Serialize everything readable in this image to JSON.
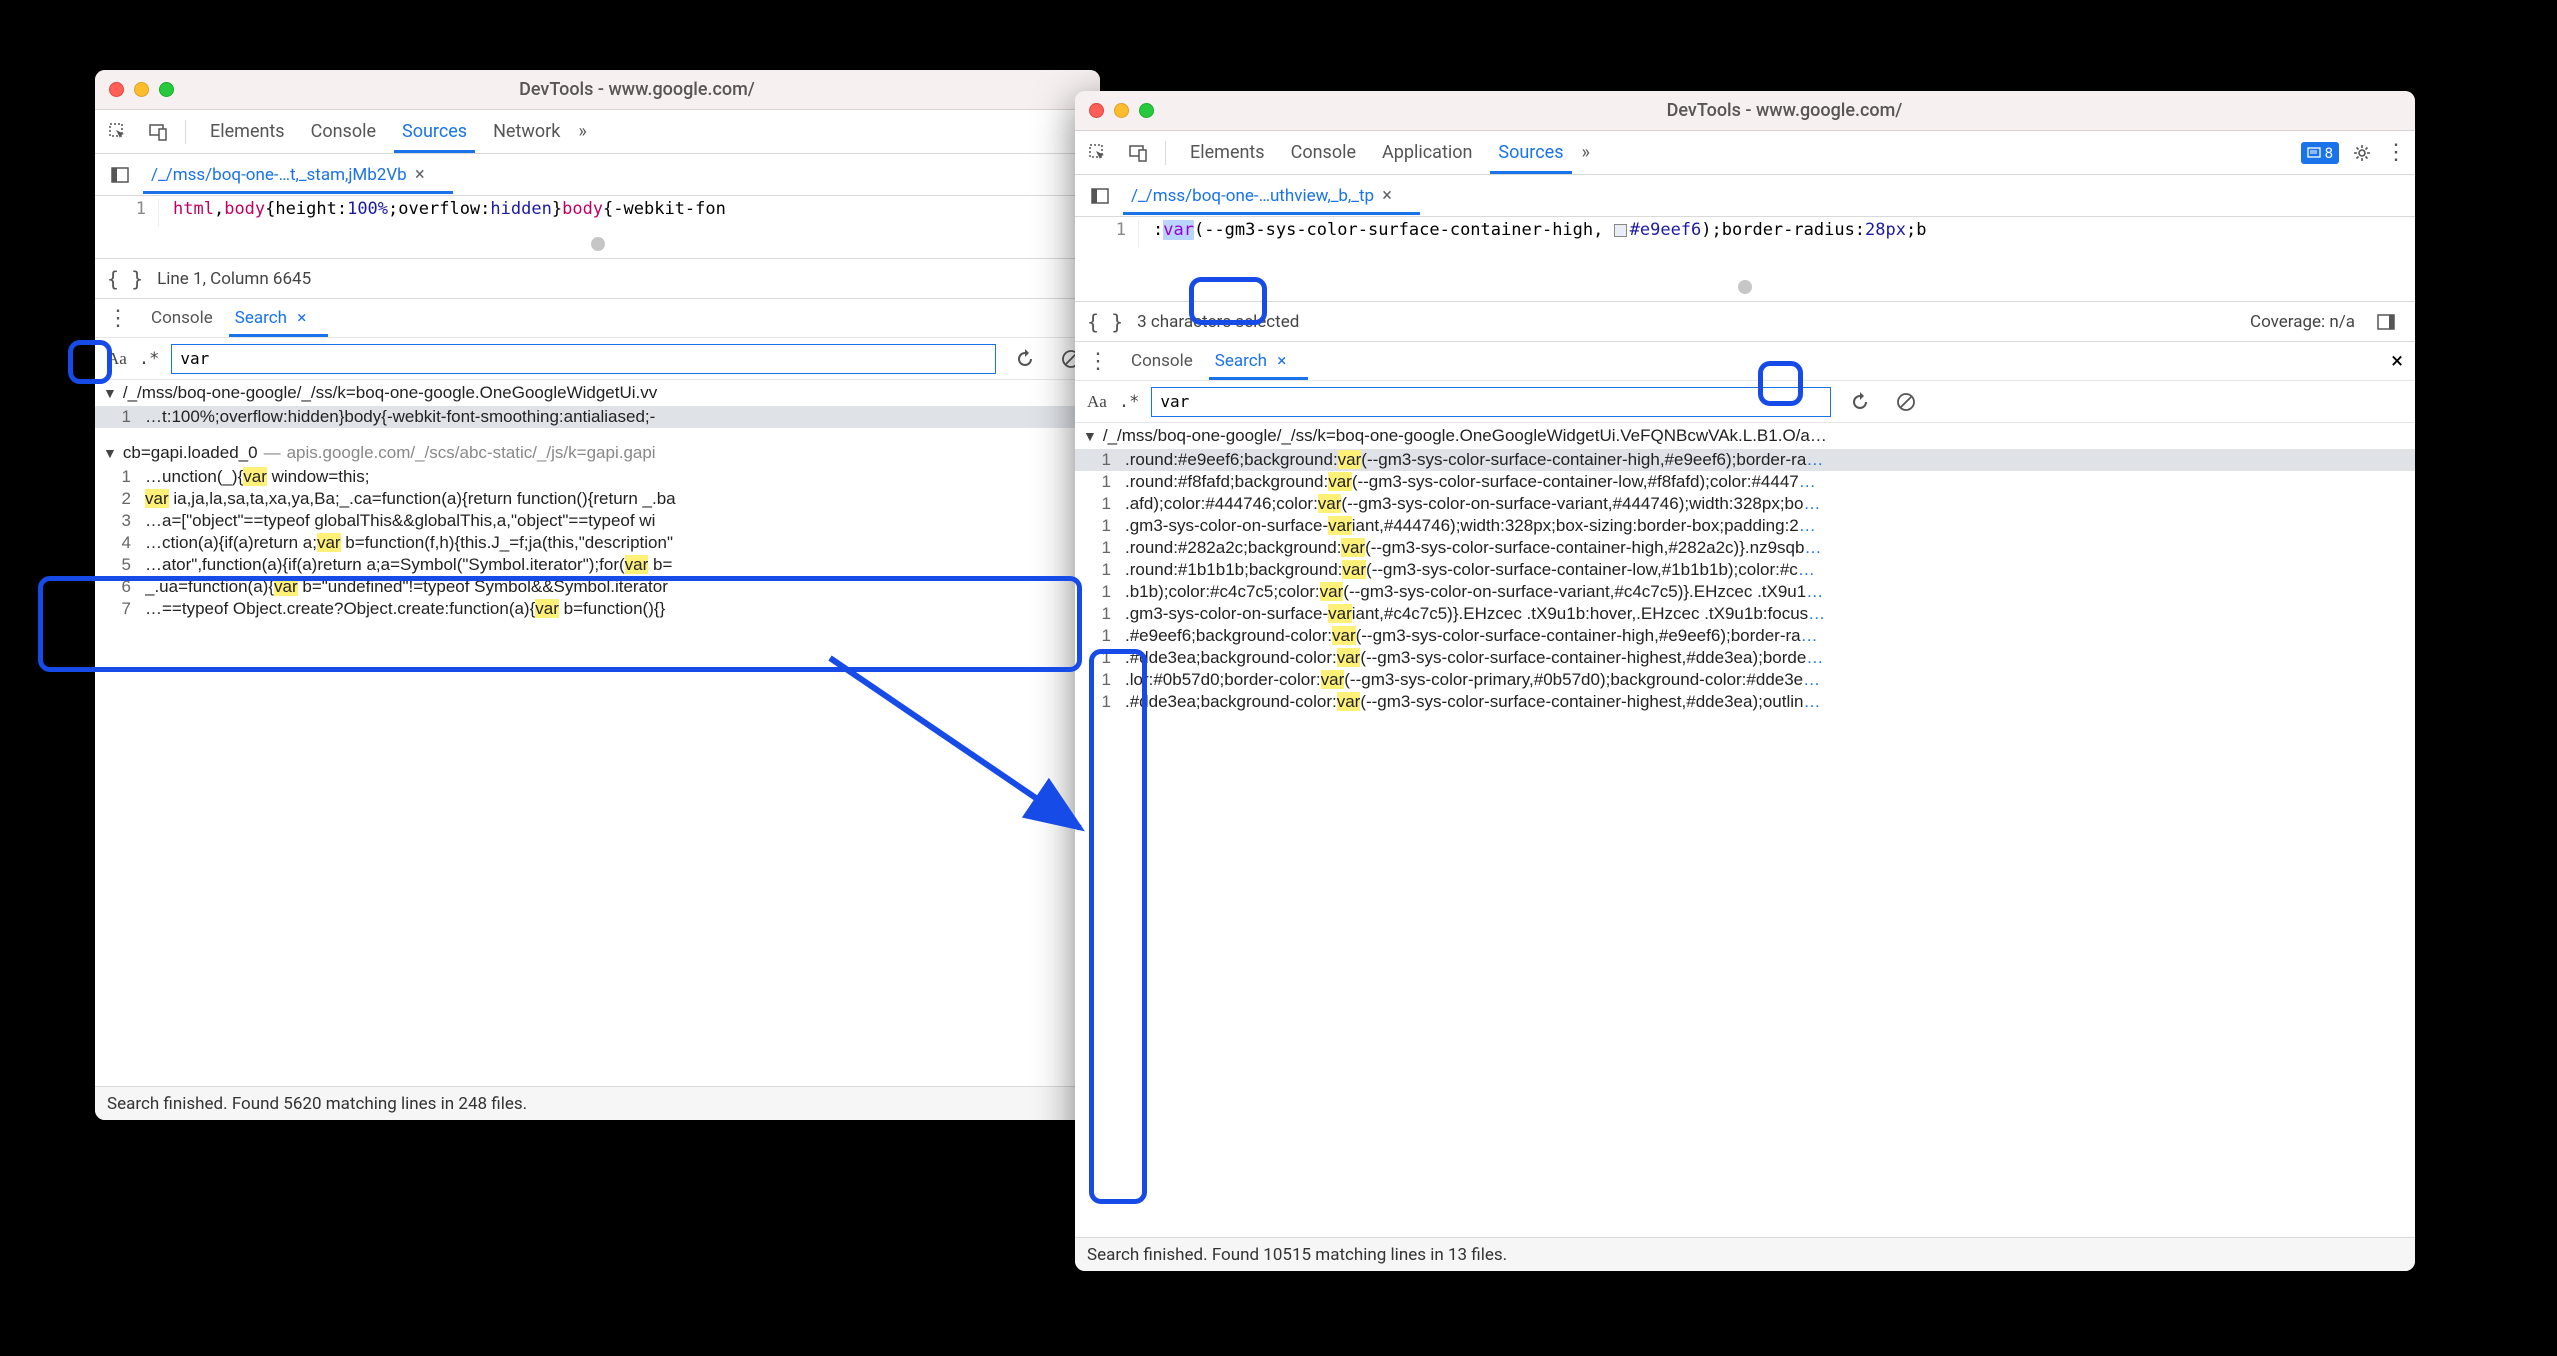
{
  "left": {
    "title": "DevTools - www.google.com/",
    "tabs": [
      "Elements",
      "Console",
      "Sources",
      "Network"
    ],
    "activeTab": "Sources",
    "filename": "/_/mss/boq-one-…t,_stam,jMb2Vb",
    "code": {
      "line": "1",
      "selector1": "html",
      "selector2": "body",
      "prop1": "height",
      "val1": "100%",
      "prop2": "overflow",
      "val2": "hidden",
      "selector3": "body",
      "tail": "{-webkit-fon"
    },
    "statusLine": "Line 1, Column 6645",
    "drawerTabs": {
      "console": "Console",
      "search": "Search"
    },
    "search": "var",
    "group1": "/_/mss/boq-one-google/_/ss/k=boq-one-google.OneGoogleWidgetUi.vv",
    "row1": {
      "ln": "1",
      "txt": "…t:100%;overflow:hidden}body{-webkit-font-smoothing:antialiased;-"
    },
    "group2a": "cb=gapi.loaded_0",
    "group2b": "apis.google.com/_/scs/abc-static/_/js/k=gapi.gapi",
    "rows": [
      {
        "ln": "1",
        "pre": "…unction(_){",
        "hl": "var",
        "post": " window=this;"
      },
      {
        "ln": "2",
        "pre": "",
        "hl": "var",
        "post": " ia,ja,la,sa,ta,xa,ya,Ba;_.ca=function(a){return function(){return _.ba"
      },
      {
        "ln": "3",
        "pre": "…a=[\"object\"==typeof globalThis&&globalThis,a,\"object\"==typeof wi",
        "hl": "",
        "post": ""
      },
      {
        "ln": "4",
        "pre": "…ction(a){if(a)return a;",
        "hl": "var",
        "post": " b=function(f,h){this.J_=f;ja(this,\"description\""
      },
      {
        "ln": "5",
        "pre": "…ator\",function(a){if(a)return a;a=Symbol(\"Symbol.iterator\");for(",
        "hl": "var",
        "post": " b="
      },
      {
        "ln": "6",
        "pre": "_.ua=function(a){",
        "hl": "var",
        "post": " b=\"undefined\"!=typeof Symbol&&Symbol.iterator"
      },
      {
        "ln": "7",
        "pre": "…==typeof Object.create?Object.create:function(a){",
        "hl": "var",
        "post": " b=function(){}"
      }
    ],
    "footer": "Search finished.  Found 5620 matching lines in 248 files."
  },
  "right": {
    "title": "DevTools - www.google.com/",
    "tabs": [
      "Elements",
      "Console",
      "Application",
      "Sources"
    ],
    "activeTab": "Sources",
    "badgeCount": "8",
    "filename": "/_/mss/boq-one-…uthview,_b,_tp",
    "code": {
      "line": "1",
      "lead": ":",
      "kw": "var",
      "mid": "(--gm3-sys-color-surface-container-high,",
      "clr": "#e9eef6",
      "post": ");border-radius:",
      "num": "28px",
      "tail": ";b"
    },
    "statusLeft": "3 characters selected",
    "statusRight": "Coverage: n/a",
    "drawerTabs": {
      "console": "Console",
      "search": "Search"
    },
    "search": "var",
    "group1": "/_/mss/boq-one-google/_/ss/k=boq-one-google.OneGoogleWidgetUi.VeFQNBcwVAk.L.B1.O/a…",
    "rows": [
      {
        "ln": "1",
        "pre": ".round:#e9eef6;background:",
        "hl": "var",
        "post": "(--gm3-sys-color-surface-container-high,#e9eef6);border-ra",
        "more": "…",
        "sel": true
      },
      {
        "ln": "1",
        "pre": ".round:#f8fafd;background:",
        "hl": "var",
        "post": "(--gm3-sys-color-surface-container-low,#f8fafd);color:#4447",
        "more": "…"
      },
      {
        "ln": "1",
        "pre": ".afd);color:#444746;color:",
        "hl": "var",
        "post": "(--gm3-sys-color-on-surface-variant,#444746);width:328px;bo",
        "more": "…"
      },
      {
        "ln": "1",
        "pre": ".gm3-sys-color-on-surface-",
        "hl": "var",
        "post": "iant,#444746);width:328px;box-sizing:border-box;padding:2",
        "more": "…"
      },
      {
        "ln": "1",
        "pre": ".round:#282a2c;background:",
        "hl": "var",
        "post": "(--gm3-sys-color-surface-container-high,#282a2c)}.nz9sqb",
        "more": "…"
      },
      {
        "ln": "1",
        "pre": ".round:#1b1b1b;background:",
        "hl": "var",
        "post": "(--gm3-sys-color-surface-container-low,#1b1b1b);color:#c",
        "more": "…"
      },
      {
        "ln": "1",
        "pre": ".b1b);color:#c4c7c5;color:",
        "hl": "var",
        "post": "(--gm3-sys-color-on-surface-variant,#c4c7c5)}.EHzcec .tX9u1",
        "more": "…"
      },
      {
        "ln": "1",
        "pre": ".gm3-sys-color-on-surface-",
        "hl": "var",
        "post": "iant,#c4c7c5)}.EHzcec .tX9u1b:hover,.EHzcec .tX9u1b:focus",
        "more": "…"
      },
      {
        "ln": "1",
        "pre": ".#e9eef6;background-color:",
        "hl": "var",
        "post": "(--gm3-sys-color-surface-container-high,#e9eef6);border-ra",
        "more": "…"
      },
      {
        "ln": "1",
        "pre": ".#dde3ea;background-color:",
        "hl": "var",
        "post": "(--gm3-sys-color-surface-container-highest,#dde3ea);borde",
        "more": "…"
      },
      {
        "ln": "1",
        "pre": ".lor:#0b57d0;border-color:",
        "hl": "var",
        "post": "(--gm3-sys-color-primary,#0b57d0);background-color:#dde3e",
        "more": "…"
      },
      {
        "ln": "1",
        "pre": ".#dde3ea;background-color:",
        "hl": "var",
        "post": "(--gm3-sys-color-surface-container-highest,#dde3ea);outlin",
        "more": "…"
      }
    ],
    "footer": "Search finished.  Found 10515 matching lines in 13 files."
  }
}
